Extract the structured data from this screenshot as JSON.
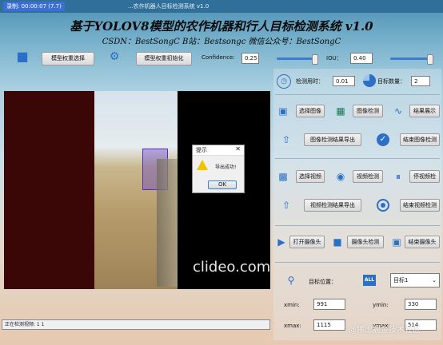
{
  "titlebar": {
    "badge": "录制: 00:00:07 (7.7)",
    "text": "...农作机器人目标检测系统 v1.0"
  },
  "header": {
    "title": "基于YOLOV8模型的农作机器和行人目标检测系统 v1.0",
    "subtitle": "CSDN：BestSongC   B站：Bestsongc   微信公众号：BestSongC"
  },
  "toolbar": {
    "select_weights": "模型权重选择",
    "init_weights": "模型权重初始化",
    "confidence_label": "Confidence:",
    "confidence_value": "0.25",
    "iou_label": "IOU：",
    "iou_value": "0.40"
  },
  "stats": {
    "time_label": "检测用时：",
    "time_value": "0.01",
    "count_label": "目标数量：",
    "count_value": "2"
  },
  "image_row": {
    "select": "选择图像",
    "detect": "图像检测",
    "show": "结果展示"
  },
  "image_export": {
    "export": "图像检测结果导出",
    "finish": "结束图像检测"
  },
  "video_row": {
    "select": "选择视频",
    "detect": "视频检测",
    "stop": "停视频检"
  },
  "video_export": {
    "export": "视频检测结果导出",
    "finish": "结束视频检测"
  },
  "camera_row": {
    "open": "打开摄像头",
    "detect": "摄像头检测",
    "finish": "结束摄像头"
  },
  "target": {
    "pos_label": "目标位置：",
    "all_badge": "ALL",
    "select_value": "目标1",
    "xmin_label": "xmin:",
    "xmin_value": "991",
    "ymin_label": "ymin:",
    "ymin_value": "330",
    "xmax_label": "xmax:",
    "xmax_value": "1115",
    "ymax_label": "ymax:",
    "ymax_value": "514"
  },
  "dialog": {
    "title": "提示",
    "message": "导出成功!",
    "ok": "OK",
    "close": "✕"
  },
  "video": {
    "watermark": "clideo.com"
  },
  "status": {
    "text": "正在检测视频: 1 1"
  },
  "watermark": "@稀土掘金技术社区",
  "colors": {
    "accent": "#2b6fc6",
    "dialog_warn": "#f2c200"
  }
}
